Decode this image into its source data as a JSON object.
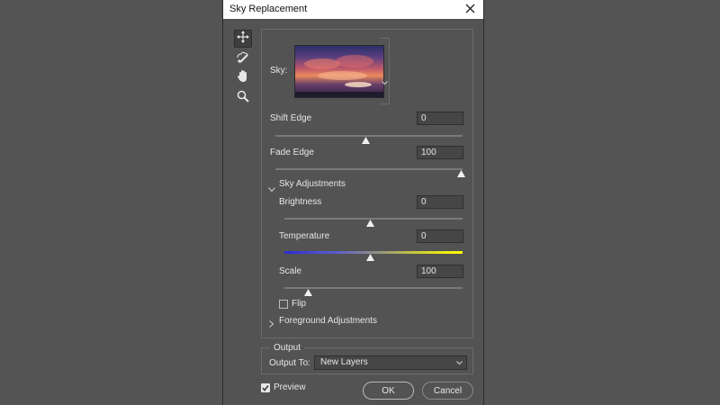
{
  "dialog": {
    "title": "Sky Replacement"
  },
  "toolbar": {
    "tools": [
      "move-tool",
      "sky-brush-tool",
      "hand-tool",
      "zoom-tool"
    ]
  },
  "sky": {
    "label": "Sky:"
  },
  "shift_edge": {
    "label": "Shift Edge",
    "value": "0",
    "level": 0.5
  },
  "fade_edge": {
    "label": "Fade Edge",
    "value": "100",
    "level": 1.0
  },
  "sky_adjustments": {
    "label": "Sky Adjustments",
    "expanded": true,
    "brightness": {
      "label": "Brightness",
      "value": "0",
      "level": 0.5
    },
    "temperature": {
      "label": "Temperature",
      "value": "0",
      "level": 0.5
    },
    "scale": {
      "label": "Scale",
      "value": "100",
      "level": 0.14
    },
    "flip": {
      "label": "Flip",
      "checked": false
    }
  },
  "foreground_adjustments": {
    "label": "Foreground Adjustments",
    "expanded": false
  },
  "output": {
    "legend": "Output",
    "output_to_label": "Output To:",
    "output_to_value": "New Layers"
  },
  "preview": {
    "label": "Preview",
    "checked": true
  },
  "buttons": {
    "ok": "OK",
    "cancel": "Cancel"
  },
  "colors": {
    "dialog_bg": "#535353",
    "field_bg": "#464646",
    "text": "#e6e6e6"
  }
}
